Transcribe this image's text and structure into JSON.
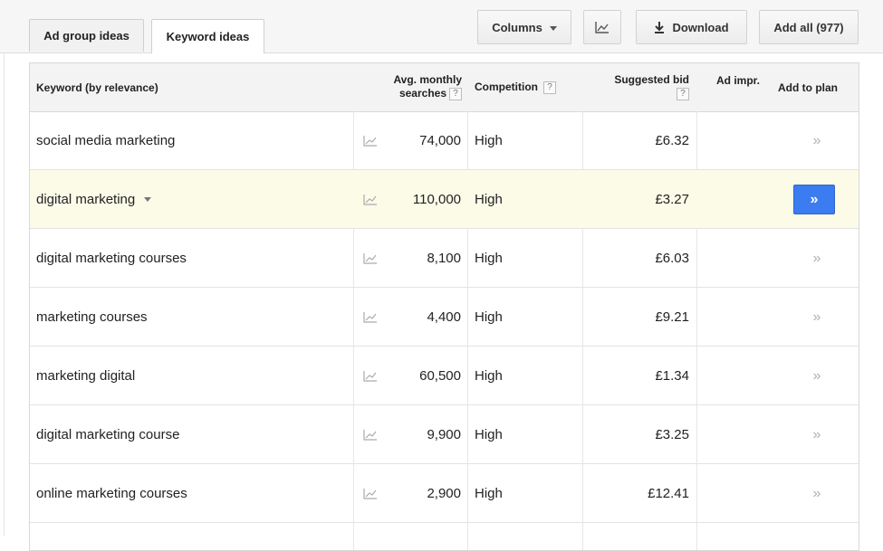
{
  "tabs": [
    {
      "label": "Ad group ideas",
      "active": false
    },
    {
      "label": "Keyword ideas",
      "active": true
    }
  ],
  "toolbar": {
    "columns_label": "Columns",
    "download_label": "Download",
    "add_all_label": "Add all (977)"
  },
  "table": {
    "headers": {
      "keyword": "Keyword (by relevance)",
      "avg_line1": "Avg. monthly",
      "avg_line2": "searches",
      "competition": "Competition",
      "bid_line1": "Suggested bid",
      "ad_impr": "Ad impr.",
      "add_to_plan": "Add to plan",
      "help": "?"
    },
    "rows": [
      {
        "keyword": "social media marketing",
        "searches": "74,000",
        "competition": "High",
        "bid": "£6.32",
        "add": "»"
      },
      {
        "keyword": "digital marketing",
        "searches": "110,000",
        "competition": "High",
        "bid": "£3.27",
        "add": "»"
      },
      {
        "keyword": "digital marketing courses",
        "searches": "8,100",
        "competition": "High",
        "bid": "£6.03",
        "add": "»"
      },
      {
        "keyword": "marketing courses",
        "searches": "4,400",
        "competition": "High",
        "bid": "£9.21",
        "add": "»"
      },
      {
        "keyword": "marketing digital",
        "searches": "60,500",
        "competition": "High",
        "bid": "£1.34",
        "add": "»"
      },
      {
        "keyword": "digital marketing course",
        "searches": "9,900",
        "competition": "High",
        "bid": "£3.25",
        "add": "»"
      },
      {
        "keyword": "online marketing courses",
        "searches": "2,900",
        "competition": "High",
        "bid": "£12.41",
        "add": "»"
      }
    ]
  },
  "colors": {
    "highlight_row": "#fbfbe8",
    "primary_button": "#3b7cf0"
  }
}
